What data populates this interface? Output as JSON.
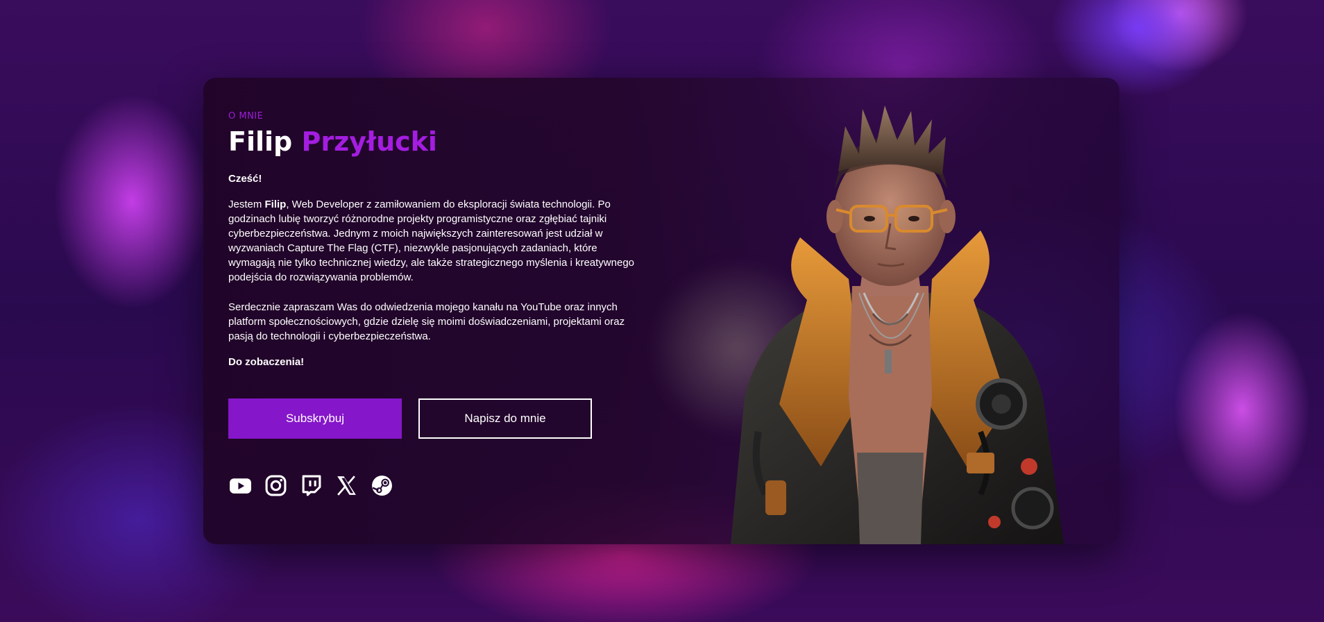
{
  "about": {
    "eyebrow": "O MNIE",
    "first_name": "Filip",
    "last_name": "Przyłucki",
    "greeting": "Cześć!",
    "intro_before": "Jestem ",
    "intro_name": "Filip",
    "intro_after": ", Web Developer z zamiłowaniem do eksploracji świata technologii. Po godzinach lubię tworzyć różnorodne projekty programistyczne oraz zgłębiać tajniki cyberbezpieczeństwa. Jednym z moich największych zainteresowań jest udział w wyzwaniach Capture The Flag (CTF), niezwykle pasjonujących zadaniach, które wymagają nie tylko technicznej wiedzy, ale także strategicznego myślenia i kreatywnego podejścia do rozwiązywania problemów.",
    "invite": "Serdecznie zapraszam Was do odwiedzenia mojego kanału na YouTube oraz innych platform społecznościowych, gdzie dzielę się moimi doświadczeniami, projektami oraz pasją do technologii i cyberbezpieczeństwa.",
    "signoff": "Do zobaczenia!"
  },
  "buttons": {
    "subscribe": "Subskrybuj",
    "contact": "Napisz do mnie"
  },
  "socials": [
    "youtube-icon",
    "instagram-icon",
    "twitch-icon",
    "x-icon",
    "steam-icon"
  ],
  "colors": {
    "accent": "#8516c9",
    "accent_text": "#a41de0",
    "card_bg": "#200426"
  }
}
